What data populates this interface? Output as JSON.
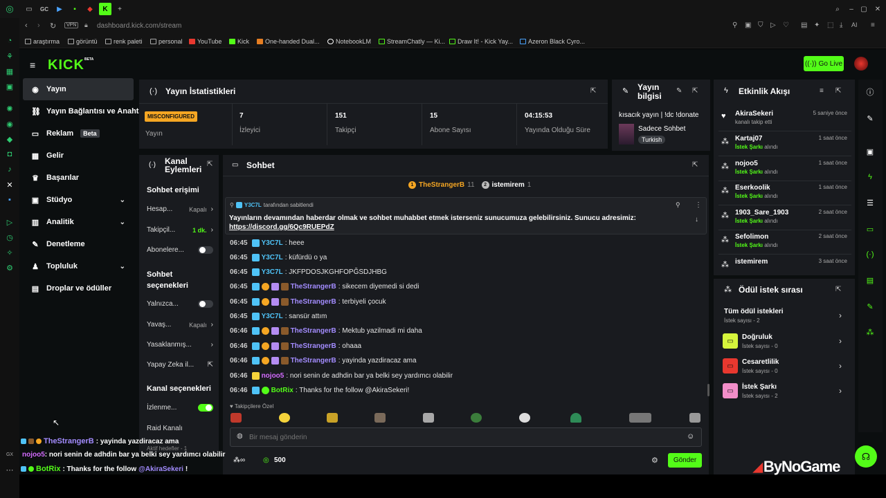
{
  "browser": {
    "url_host": "dashboard.kick.com",
    "url_path": "/stream",
    "vpn_label": "VPN",
    "ai_label": "AI",
    "tab_gc": "GC",
    "bookmarks": [
      "araştırma",
      "görüntü",
      "renk paleti",
      "personal",
      "YouTube",
      "Kick",
      "One-handed Dual...",
      "NotebookLM",
      "StreamChatly — Ki...",
      "Draw It! - Kick Yay...",
      "Azeron Black Cyro..."
    ]
  },
  "header": {
    "go_live": "Go Live",
    "beta": "BETA"
  },
  "nav": {
    "items": [
      {
        "label": "Yayın"
      },
      {
        "label": "Yayın Bağlantısı ve Anahtar"
      },
      {
        "label": "Reklam",
        "badge": "Beta"
      },
      {
        "label": "Gelir"
      },
      {
        "label": "Başarılar"
      },
      {
        "label": "Stüdyo"
      },
      {
        "label": "Analitik"
      },
      {
        "label": "Denetleme"
      },
      {
        "label": "Topluluk"
      },
      {
        "label": "Droplar ve ödüller"
      }
    ]
  },
  "stats": {
    "title": "Yayın İstatistikleri",
    "status_badge": "MISCONFIGURED",
    "status_label": "Yayın",
    "viewers_val": "7",
    "viewers_lbl": "İzleyici",
    "followers_val": "151",
    "followers_lbl": "Takipçi",
    "subs_val": "15",
    "subs_lbl": "Abone Sayısı",
    "uptime_val": "04:15:53",
    "uptime_lbl": "Yayında Olduğu Süre"
  },
  "stream_info": {
    "title": "Yayın bilgisi",
    "stream_title": "kısacık yayın | !dc !donate",
    "category": "Sadece Sohbet",
    "language": "Turkish"
  },
  "actions": {
    "title": "Kanal Eylemleri",
    "section_chat": "Sohbet erişimi",
    "hesap": "Hesap...",
    "hesap_val": "Kapalı",
    "takipci": "Takipçil...",
    "takipci_val": "1 dk.",
    "abone": "Abonelere...",
    "section_opts": "Sohbet seçenekleri",
    "yalniz": "Yalnızca...",
    "yavas": "Yavaş...",
    "yavas_val": "Kapalı",
    "yasak": "Yasaklanmış...",
    "yapay": "Yapay Zeka il...",
    "section_channel": "Kanal seçenekleri",
    "izlenme": "İzlenme...",
    "raid": "Raid Kanalı",
    "aktif": "Aktif hedefler - 1"
  },
  "chat": {
    "title": "Sohbet",
    "top1_name": "TheStrangerB",
    "top1_count": "11",
    "top2_name": "istemirem",
    "top2_count": "1",
    "pinned_by": "Y3C7L",
    "pinned_suffix": "tarafından sabitlendi",
    "pinned_text": "Yayınların devamından haberdar olmak ve sohbet muhabbet etmek isterseniz sunucumuza gelebilirsiniz. Sunucu adresimiz:",
    "pinned_link": "https://discord.gg/6Qc9RUEPdZ",
    "messages": [
      {
        "time": "06:45",
        "user": "Y3C7L",
        "text": ": heee"
      },
      {
        "time": "06:45",
        "user": "Y3C7L",
        "text": ": küfürdü o ya"
      },
      {
        "time": "06:45",
        "user": "Y3C7L",
        "text": ": JKFPDOSJKGHFOPĞSDJHBG"
      },
      {
        "time": "06:45",
        "user": "TheStrangerB",
        "text": ": sikecem diyemedi si dedi"
      },
      {
        "time": "06:45",
        "user": "TheStrangerB",
        "text": ": terbiyeli çocuk"
      },
      {
        "time": "06:45",
        "user": "Y3C7L",
        "text": ": sansür attım"
      },
      {
        "time": "06:46",
        "user": "TheStrangerB",
        "text": ": Mektub yazilmadi mi daha"
      },
      {
        "time": "06:46",
        "user": "TheStrangerB",
        "text": ": ohaaa"
      },
      {
        "time": "06:46",
        "user": "TheStrangerB",
        "text": ": yayinda yazdiracaz ama"
      },
      {
        "time": "06:46",
        "user": "nojoo5",
        "text": ": nori senin de adhdin bar ya belki sey yardımcı olabilir"
      },
      {
        "time": "06:46",
        "user": "BotRix",
        "text": ": Thanks for the follow @AkiraSekeri!"
      }
    ],
    "followers_only": "Takipçilere Özel",
    "input_placeholder": "Bir mesaj gönderin",
    "points": "500",
    "send": "Gönder"
  },
  "events": {
    "title": "Etkinlik Akışı",
    "rows": [
      {
        "name": "AkiraSekeri",
        "sub": "kanalı takip etti",
        "time": "5 saniye önce"
      },
      {
        "name": "Kartaj07",
        "sub_b": "İstek Şarkı",
        "sub": " alındı",
        "time": "1 saat önce"
      },
      {
        "name": "nojoo5",
        "sub_b": "İstek Şarkı",
        "sub": " alındı",
        "time": "1 saat önce"
      },
      {
        "name": "Eserkoolik",
        "sub_b": "İstek Şarkı",
        "sub": " alındı",
        "time": "1 saat önce"
      },
      {
        "name": "1903_Sare_1903",
        "sub_b": "İstek Şarkı",
        "sub": " alındı",
        "time": "2 saat önce"
      },
      {
        "name": "Sefolimon",
        "sub_b": "İstek Şarkı",
        "sub": " alındı",
        "time": "2 saat önce"
      },
      {
        "name": "istemirem",
        "sub_b": "",
        "sub": "",
        "time": "3 saat önce"
      }
    ]
  },
  "rewards": {
    "title": "Ödül istek sırası",
    "all": "Tüm ödül istekleri",
    "all_sub": "İstek sayısı - 2",
    "items": [
      {
        "name": "Doğruluk",
        "sub": "İstek sayısı - 0",
        "color": "#d6f53c"
      },
      {
        "name": "Cesaretlilik",
        "sub": "İstek sayısı - 0",
        "color": "#e8382f"
      },
      {
        "name": "İstek Şarkı",
        "sub": "İstek sayısı - 2",
        "color": "#f28ec9"
      }
    ]
  },
  "overlay": {
    "l1_user": "TheStrangerB",
    "l1_text": ": yayinda yazdiracaz ama",
    "l2_user": "nojoo5",
    "l2_text": ": nori senin de adhdin bar ya belki sey yardımcı olabilir",
    "l3_user": "BotRix",
    "l3_text": ": Thanks for the follow ",
    "l3_mention": "@AkiraSekeri",
    "l3_end": "!",
    "watermark": "ByNoGame"
  },
  "colors": {
    "kick_green": "#53fc18",
    "purple_user": "#a38cff",
    "teal_user": "#4fc3f7",
    "pink_user": "#d36bff"
  }
}
